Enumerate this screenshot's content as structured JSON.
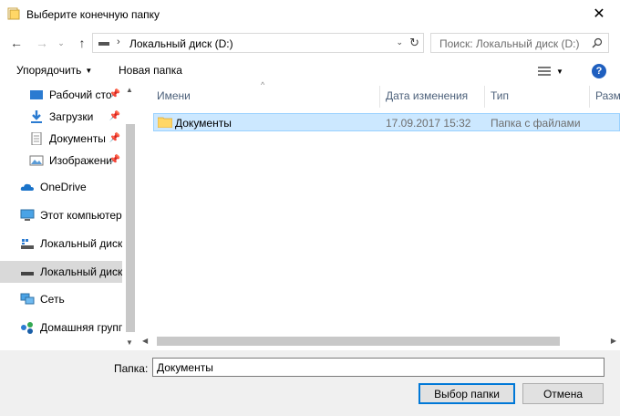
{
  "window": {
    "title": "Выберите конечную папку",
    "close_glyph": "✕"
  },
  "nav": {
    "back_glyph": "←",
    "forward_glyph": "→",
    "recent_glyph": "⌄",
    "up_glyph": "↑"
  },
  "address": {
    "separator": "›",
    "path": "Локальный диск (D:)",
    "dropdown_glyph": "⌄",
    "refresh_glyph": "↻"
  },
  "search": {
    "placeholder": "Поиск: Локальный диск (D:)"
  },
  "toolbar": {
    "organize_label": "Упорядочить",
    "new_folder_label": "Новая папка",
    "help_label": "?"
  },
  "sidebar": {
    "items": [
      {
        "label": "Рабочий сто",
        "icon": "desktop-icon",
        "pinned": true
      },
      {
        "label": "Загрузки",
        "icon": "download-icon",
        "pinned": true
      },
      {
        "label": "Документы",
        "icon": "documents-icon",
        "pinned": true
      },
      {
        "label": "Изображени",
        "icon": "pictures-icon",
        "pinned": true
      },
      {
        "label": "OneDrive",
        "icon": "cloud-icon",
        "pinned": false
      },
      {
        "label": "Этот компьютер",
        "icon": "computer-icon",
        "pinned": false
      },
      {
        "label": "Локальный диск",
        "icon": "drive-icon",
        "pinned": false
      },
      {
        "label": "Локальный диск",
        "icon": "drive-icon",
        "pinned": false,
        "selected": true
      },
      {
        "label": "Сеть",
        "icon": "network-icon",
        "pinned": false
      },
      {
        "label": "Домашняя групп",
        "icon": "homegroup-icon",
        "pinned": false
      }
    ]
  },
  "columns": {
    "name": "Имени",
    "date": "Дата изменения",
    "type": "Тип",
    "size": "Разм"
  },
  "files": [
    {
      "name": "Документы",
      "date": "17.09.2017 15:32",
      "type": "Папка с файлами"
    }
  ],
  "footer": {
    "folder_label": "Папка:",
    "folder_value": "Документы",
    "select_button": "Выбор папки",
    "cancel_button": "Отмена"
  },
  "colors": {
    "selection_bg": "#cce8ff",
    "selection_border": "#99d1ff",
    "help_blue": "#1f5fbf",
    "folder_yellow": "#ffd766"
  }
}
